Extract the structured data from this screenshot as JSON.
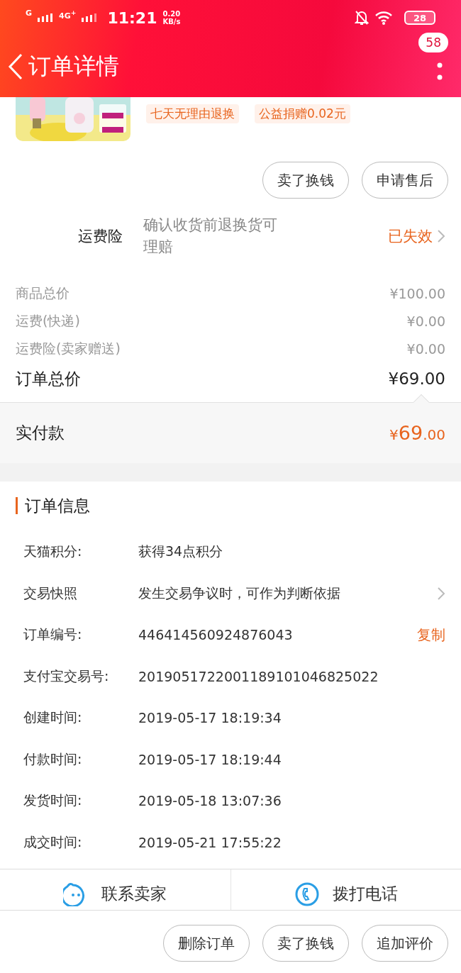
{
  "status_bar": {
    "network_1": "G",
    "network_2": "4G$^{+}$",
    "time": "11:21",
    "speed": "0.20",
    "speed_unit": "KB/s",
    "battery": "28"
  },
  "header": {
    "title": "订单详情",
    "badge": "58"
  },
  "product": {
    "image": {
      "kind": "picture"
    },
    "tags": [
      "七天无理由退换",
      "公益捐赠0.02元"
    ]
  },
  "top_actions": [
    "卖了换钱",
    "申请售后"
  ],
  "insurance": {
    "label": "运费险",
    "description": "确认收货前退换货可理赔",
    "status": "已失效"
  },
  "prices": [
    {
      "label": "商品总价",
      "value": "¥100.00",
      "kind": "minor"
    },
    {
      "label": "运费(快递)",
      "value": "¥0.00",
      "kind": "minor"
    },
    {
      "label": "运费险(卖家赠送)",
      "value": "¥0.00",
      "kind": "minor"
    },
    {
      "label": "订单总价",
      "value": "¥69.00",
      "kind": "total"
    }
  ],
  "paid": {
    "label": "实付款",
    "currency": "¥",
    "whole": "69",
    "fraction": ".00"
  },
  "order_info": {
    "title": "订单信息",
    "rows": [
      {
        "label": "天猫积分:",
        "value": "获得34点积分",
        "kind": "text"
      },
      {
        "label": "交易快照",
        "value": "发生交易争议时，可作为判断依据",
        "kind": "link"
      },
      {
        "label": "订单编号:",
        "value": "446414560924876043",
        "kind": "copy",
        "action": "复制"
      },
      {
        "label": "支付宝交易号:",
        "value": "2019051722001189101046825022",
        "kind": "text"
      },
      {
        "label": "创建时间:",
        "value": "2019-05-17 18:19:34",
        "kind": "text"
      },
      {
        "label": "付款时间:",
        "value": "2019-05-17 18:19:44",
        "kind": "text"
      },
      {
        "label": "发货时间:",
        "value": "2019-05-18 13:07:36",
        "kind": "text"
      },
      {
        "label": "成交时间:",
        "value": "2019-05-21 17:55:22",
        "kind": "text"
      }
    ]
  },
  "contact": [
    {
      "label": "联系卖家",
      "kind": "chat"
    },
    {
      "label": "拨打电话",
      "kind": "phone"
    }
  ],
  "bottom_actions": [
    "删除订单",
    "卖了换钱",
    "追加评价"
  ]
}
